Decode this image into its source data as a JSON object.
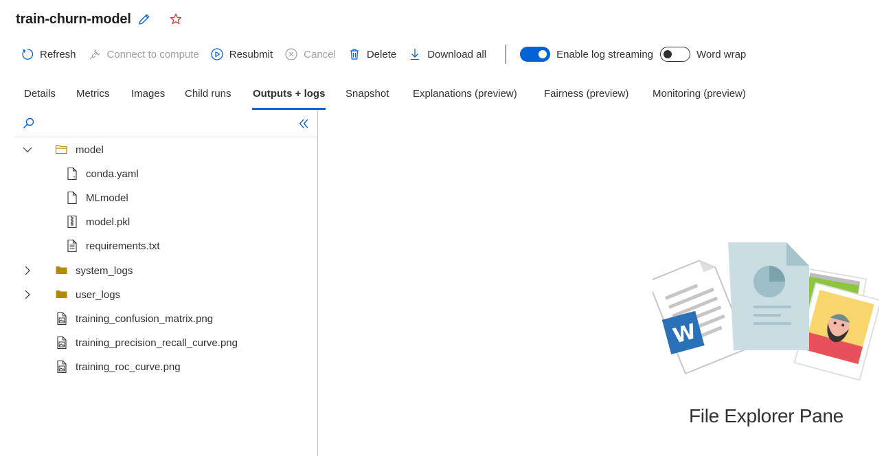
{
  "header": {
    "title": "train-churn-model"
  },
  "toolbar": {
    "refresh": "Refresh",
    "connect": "Connect to compute",
    "resubmit": "Resubmit",
    "cancel": "Cancel",
    "delete": "Delete",
    "download_all": "Download all",
    "log_streaming": "Enable log streaming",
    "log_streaming_on": true,
    "word_wrap": "Word wrap",
    "word_wrap_on": false
  },
  "tabs": [
    {
      "label": "Details"
    },
    {
      "label": "Metrics"
    },
    {
      "label": "Images"
    },
    {
      "label": "Child runs"
    },
    {
      "label": "Outputs + logs",
      "active": true
    },
    {
      "label": "Snapshot"
    },
    {
      "label": "Explanations (preview)"
    },
    {
      "label": "Fairness (preview)"
    },
    {
      "label": "Monitoring (preview)"
    }
  ],
  "tree": [
    {
      "label": "model",
      "type": "folder-open",
      "expanded": true
    },
    {
      "label": "conda.yaml",
      "type": "yaml-file"
    },
    {
      "label": "MLmodel",
      "type": "file"
    },
    {
      "label": "model.pkl",
      "type": "zip-file"
    },
    {
      "label": "requirements.txt",
      "type": "text-file"
    },
    {
      "label": "system_logs",
      "type": "folder",
      "expanded": false
    },
    {
      "label": "user_logs",
      "type": "folder",
      "expanded": false
    },
    {
      "label": "training_confusion_matrix.png",
      "type": "image-file"
    },
    {
      "label": "training_precision_recall_curve.png",
      "type": "image-file"
    },
    {
      "label": "training_roc_curve.png",
      "type": "image-file"
    }
  ],
  "empty_state": {
    "label": "File Explorer Pane"
  },
  "colors": {
    "accent": "#0063d6",
    "folder": "#b48a00",
    "star": "#d13438"
  }
}
